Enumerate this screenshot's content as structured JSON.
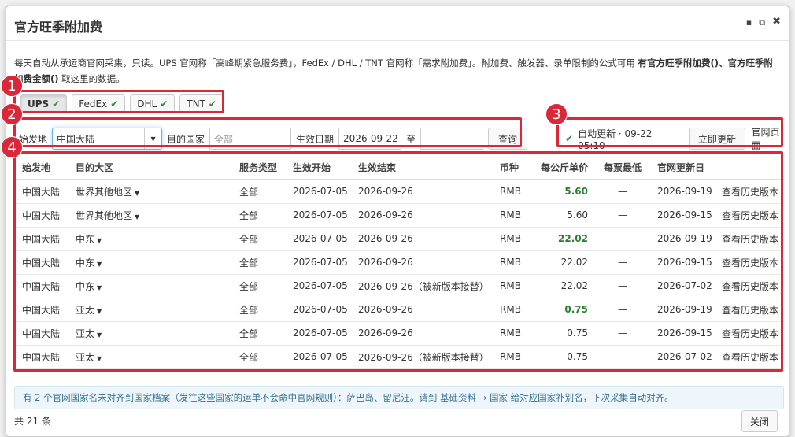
{
  "title": "官方旺季附加费",
  "header_icons": [
    "minimize-icon",
    "popout-icon",
    "close-icon"
  ],
  "description": {
    "text_1": "每天自动从承运商官网采集，只读。UPS 官网称「高峰期紧急服务费」，FedEx / DHL / TNT 官网称「需求附加费」。附加费、触发器、录单限制的公式可用 ",
    "bold_1": "有官方旺季附加费()",
    "sep": "、",
    "bold_2": "官方旺季附加费金额()",
    "text_2": " 取这里的数据。"
  },
  "carriers": [
    {
      "label": "UPS",
      "active": true
    },
    {
      "label": "FedEx",
      "active": false
    },
    {
      "label": "DHL",
      "active": false
    },
    {
      "label": "TNT",
      "active": false
    }
  ],
  "filters": {
    "origin_label": "始发地",
    "origin_value": "中国大陆",
    "dest_label": "目的国家",
    "dest_placeholder": "全部",
    "date_label": "生效日期",
    "date_from": "2026-09-22",
    "date_to_label": "至",
    "date_to": "",
    "query_button": "查询"
  },
  "auto_update": {
    "text": "自动更新 · 09-22 05:10",
    "update_button": "立即更新",
    "official_link": "官网页面"
  },
  "table": {
    "headers": [
      "始发地",
      "目的大区",
      "服务类型",
      "生效开始",
      "生效结束",
      "币种",
      "每公斤单价",
      "每票最低",
      "官网更新日",
      ""
    ],
    "rows": [
      {
        "origin": "中国大陆",
        "region": "世界其他地区",
        "service": "全部",
        "start": "2026-07-05",
        "end": "2026-09-26",
        "currency": "RMB",
        "price": "5.60",
        "price_hl": true,
        "min": "—",
        "updated": "2026-09-19",
        "action": "查看历史版本"
      },
      {
        "origin": "中国大陆",
        "region": "世界其他地区",
        "service": "全部",
        "start": "2026-07-05",
        "end": "2026-09-26",
        "currency": "RMB",
        "price": "5.60",
        "price_hl": false,
        "min": "—",
        "updated": "2026-09-15",
        "action": "查看历史版本"
      },
      {
        "origin": "中国大陆",
        "region": "中东",
        "service": "全部",
        "start": "2026-07-05",
        "end": "2026-09-26",
        "currency": "RMB",
        "price": "22.02",
        "price_hl": true,
        "min": "—",
        "updated": "2026-09-19",
        "action": "查看历史版本"
      },
      {
        "origin": "中国大陆",
        "region": "中东",
        "service": "全部",
        "start": "2026-07-05",
        "end": "2026-09-26",
        "currency": "RMB",
        "price": "22.02",
        "price_hl": false,
        "min": "—",
        "updated": "2026-09-15",
        "action": "查看历史版本"
      },
      {
        "origin": "中国大陆",
        "region": "中东",
        "service": "全部",
        "start": "2026-07-05",
        "end": "2026-09-26（被新版本接替）",
        "currency": "RMB",
        "price": "22.02",
        "price_hl": false,
        "min": "—",
        "updated": "2026-07-02",
        "action": "查看历史版本"
      },
      {
        "origin": "中国大陆",
        "region": "亚太",
        "service": "全部",
        "start": "2026-07-05",
        "end": "2026-09-26",
        "currency": "RMB",
        "price": "0.75",
        "price_hl": true,
        "min": "—",
        "updated": "2026-09-19",
        "action": "查看历史版本"
      },
      {
        "origin": "中国大陆",
        "region": "亚太",
        "service": "全部",
        "start": "2026-07-05",
        "end": "2026-09-26",
        "currency": "RMB",
        "price": "0.75",
        "price_hl": false,
        "min": "—",
        "updated": "2026-09-15",
        "action": "查看历史版本"
      },
      {
        "origin": "中国大陆",
        "region": "亚太",
        "service": "全部",
        "start": "2026-07-05",
        "end": "2026-09-26（被新版本接替）",
        "currency": "RMB",
        "price": "0.75",
        "price_hl": false,
        "min": "—",
        "updated": "2026-07-02",
        "action": "查看历史版本"
      }
    ]
  },
  "notice": "有 2 个官网国家名未对齐到国家档案（发往这些国家的运单不会命中官网规则）：萨巴岛、留尼汪。请到 基础资料 → 国家 给对应国家补别名，下次采集自动对齐。",
  "footer": {
    "count": "共 21 条",
    "close_button": "关闭"
  },
  "annotations": [
    "1",
    "2",
    "3",
    "4"
  ],
  "colors": {
    "annotation": "#d9283a",
    "price_highlight": "#2e7d32",
    "notice_bg": "#eef6fb",
    "check": "#3c8a3c"
  }
}
